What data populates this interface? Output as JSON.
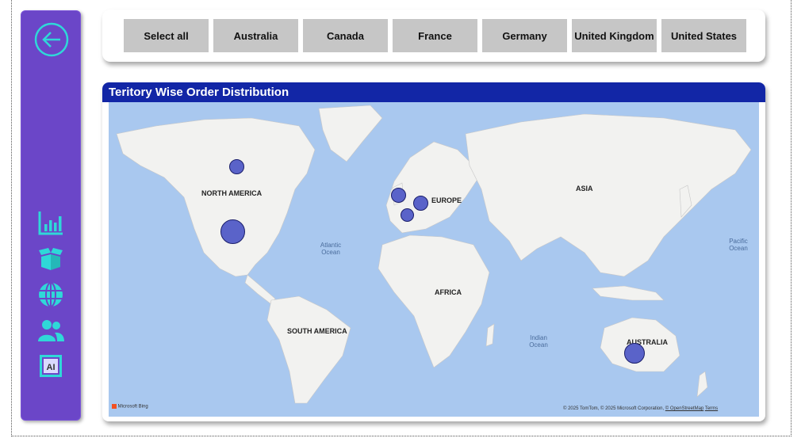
{
  "sidebar": {
    "items": [
      {
        "icon": "back-arrow-icon",
        "label": "Back"
      },
      {
        "icon": "bar-chart-icon",
        "label": "Dashboard"
      },
      {
        "icon": "box-icon",
        "label": "Products"
      },
      {
        "icon": "globe-icon",
        "label": "Territories"
      },
      {
        "icon": "users-icon",
        "label": "Customers"
      },
      {
        "icon": "ai-icon",
        "label": "AI"
      }
    ],
    "accent_color": "#2fd8d8",
    "background_color": "#6b46c8"
  },
  "slicer": {
    "options": [
      "Select all",
      "Australia",
      "Canada",
      "France",
      "Germany",
      "United Kingdom",
      "United States"
    ]
  },
  "map": {
    "title": "Teritory Wise Order Distribution",
    "continents": {
      "north_america": "NORTH AMERICA",
      "europe": "EUROPE",
      "asia": "ASIA",
      "africa": "AFRICA",
      "south_america": "SOUTH AMERICA",
      "australia": "AUSTRALIA"
    },
    "oceans": {
      "atlantic": "Atlantic Ocean",
      "pacific": "Pacific Ocean",
      "indian": "Indian Ocean"
    },
    "provider": "Microsoft Bing",
    "copyright": "© 2025 TomTom, © 2025 Microsoft Corporation,",
    "osm_link": "© OpenStreetMap",
    "terms_link": "Terms",
    "bubble_color": "#5a63c9"
  }
}
